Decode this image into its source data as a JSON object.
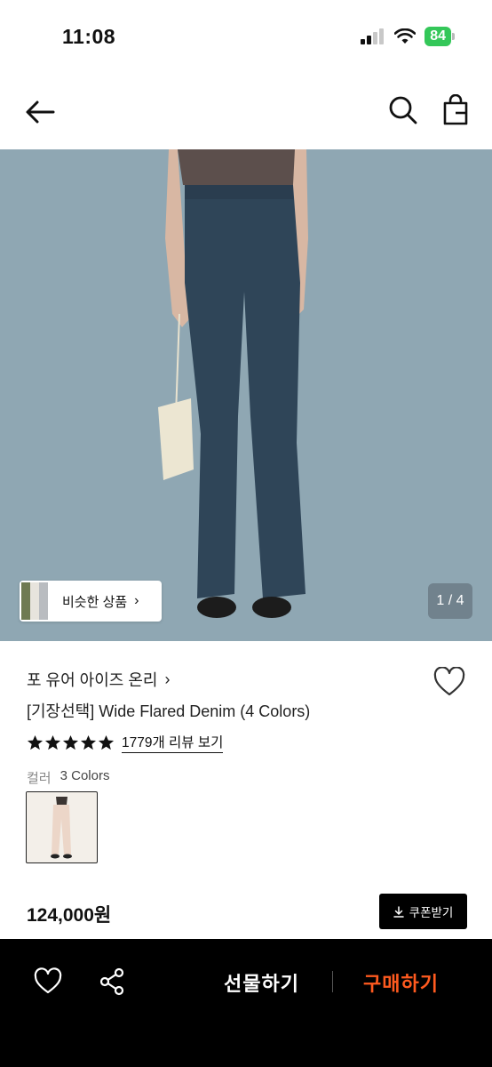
{
  "status_bar": {
    "time": "11:08",
    "battery": "84"
  },
  "hero": {
    "similar_products_label": "비슷한 상품",
    "page_indicator": "1 / 4"
  },
  "product": {
    "brand": "포 유어 아이즈 온리",
    "title": "[기장선택] Wide Flared Denim (4 Colors)",
    "rating_stars": 5,
    "review_link": "1779개 리뷰 보기",
    "color_label": "컬러",
    "color_count": "3 Colors",
    "price": "124,000원",
    "coupon_label": "쿠폰받기"
  },
  "bottom_bar": {
    "gift_label": "선물하기",
    "buy_label": "구매하기"
  },
  "colors": {
    "buy_accent": "#ff5a1f",
    "hero_background": "#8fa7b3",
    "bottom_bar": "#000000",
    "battery": "#34c759"
  }
}
